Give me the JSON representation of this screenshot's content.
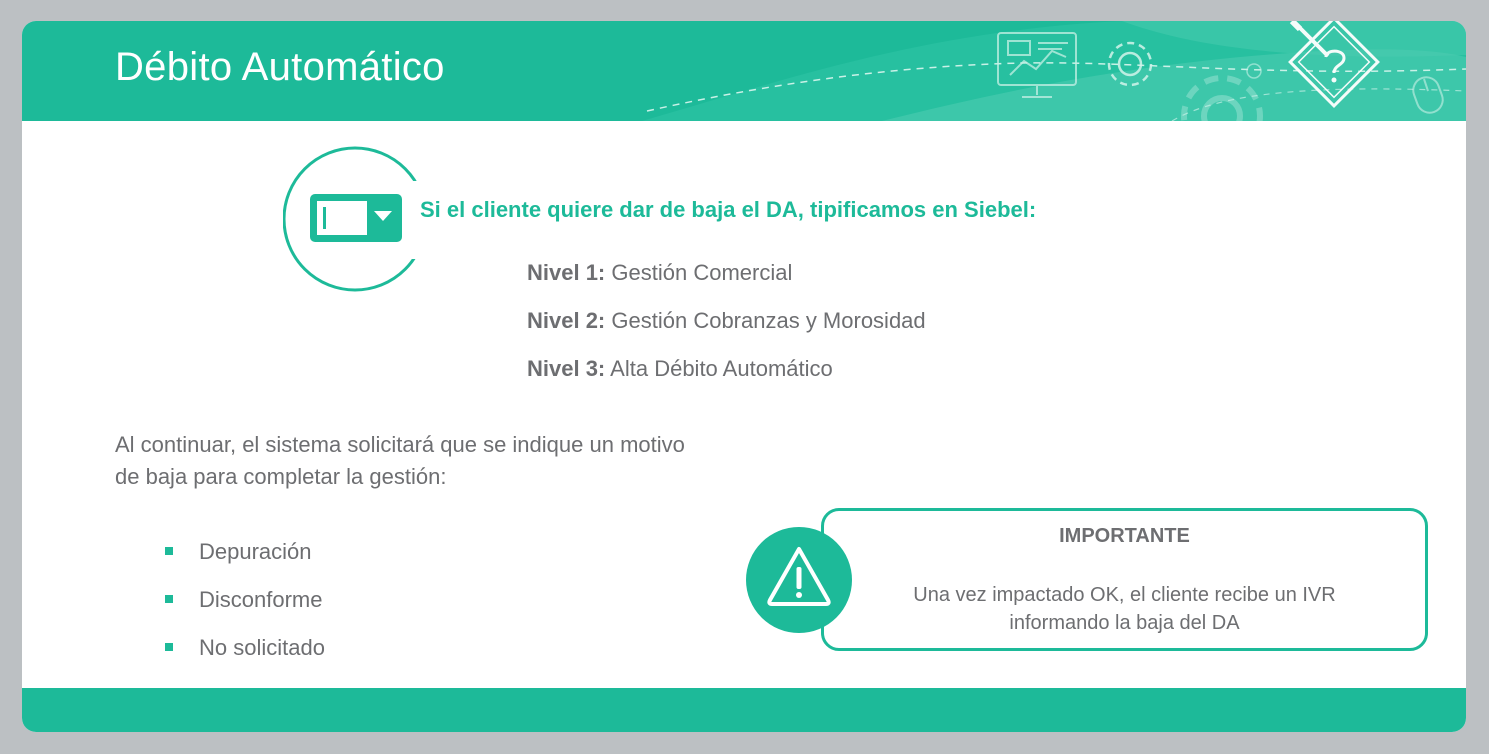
{
  "header": {
    "title": "Débito Automático"
  },
  "icons": {
    "dropdown": "dropdown-select-icon",
    "warning": "warning-triangle-icon",
    "decorations": [
      "monitor-chart-icon",
      "gear-icon",
      "large-gear-icon",
      "pencil-question-icon",
      "mouse-icon"
    ]
  },
  "colors": {
    "accent": "#1dba99",
    "text": "#6d6e71",
    "background": "#ffffff",
    "frame": "#bcc0c3"
  },
  "main": {
    "heading": "Si el cliente quiere dar de baja el DA, tipificamos en Siebel:",
    "levels": [
      {
        "label": "Nivel 1:",
        "value": "Gestión Comercial"
      },
      {
        "label": "Nivel 2:",
        "value": "Gestión Cobranzas y Morosidad"
      },
      {
        "label": "Nivel 3:",
        "value": "Alta Débito Automático"
      }
    ],
    "paragraph": "Al continuar, el sistema solicitará que se indique un motivo de baja para completar la gestión:",
    "reasons": [
      "Depuración",
      "Disconforme",
      "No solicitado"
    ]
  },
  "notice": {
    "title": "IMPORTANTE",
    "body_line1": "Una vez impactado OK, el cliente recibe un IVR",
    "body_line2": "informando la baja del DA"
  }
}
